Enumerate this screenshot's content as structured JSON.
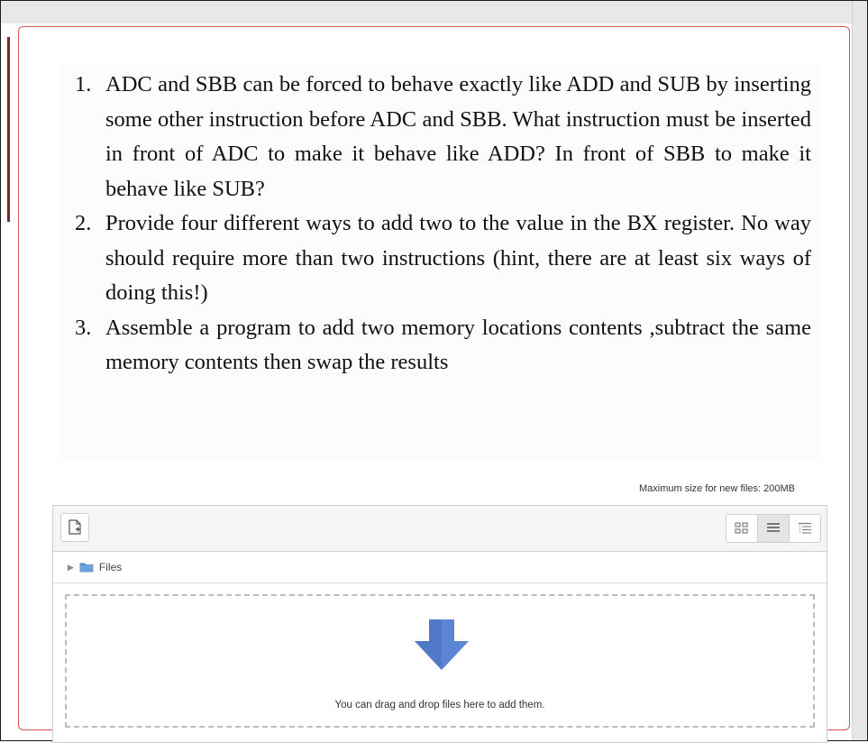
{
  "questions": [
    {
      "number": "1.",
      "text": "ADC and SBB can be forced to behave exactly like ADD and SUB by inserting some other instruction before ADC and SBB. What instruction must be inserted in front of ADC to make it behave like ADD? In front of SBB to make it behave like SUB?"
    },
    {
      "number": "2.",
      "text": "Provide four different ways to add two to the value in the BX register. No way should require more than two instructions (hint, there are at least six ways of doing this!)"
    },
    {
      "number": "3.",
      "text": "Assemble a program to add two memory locations contents ,subtract the same memory contents then swap the results"
    }
  ],
  "filemanager": {
    "max_size_label": "Maximum size for new files: 200MB",
    "path_label": "Files",
    "drop_text": "You can drag and drop files here to add them.",
    "icons": {
      "add": "add-file-icon",
      "views": [
        "grid-view-icon",
        "list-view-icon",
        "tree-view-icon"
      ],
      "folder": "folder-icon",
      "drop": "down-arrow-icon"
    },
    "active_view": "list"
  },
  "colors": {
    "card_border": "#d9534f",
    "arrow": "#5b86d6",
    "folder": "#4a86c7"
  }
}
